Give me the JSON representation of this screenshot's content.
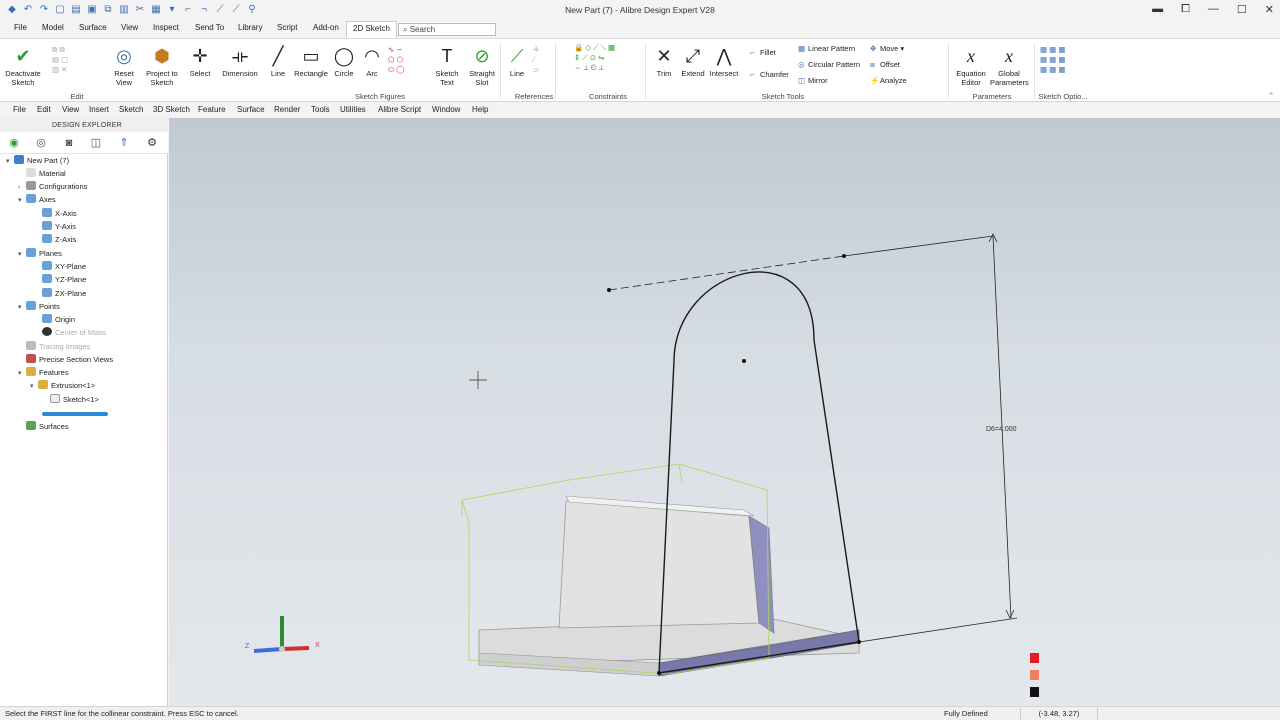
{
  "window": {
    "title": "New Part (7) - Alibre Design Expert V28"
  },
  "ribbon_tabs": [
    "File",
    "Model",
    "Surface",
    "View",
    "Inspect",
    "Send To",
    "Library",
    "Script",
    "Add-on",
    "2D Sketch"
  ],
  "search": {
    "placeholder": "Search"
  },
  "ribbon": {
    "deactivate_sketch": "Deactivate Sketch",
    "reset_view": "Reset View",
    "project_to_sketch": "Project to Sketch",
    "select": "Select",
    "dimension": "Dimension",
    "line": "Line",
    "rectangle": "Rectangle",
    "circle": "Circle",
    "arc": "Arc",
    "sketch_text": "Sketch Text",
    "straight_slot": "Straight Slot",
    "ref_line": "Line",
    "trim": "Trim",
    "extend": "Extend",
    "intersect": "Intersect",
    "fillet": "Fillet",
    "chamfer": "Chamfer",
    "linear_pattern": "Linear Pattern",
    "circular_pattern": "Circular Pattern",
    "mirror": "Mirror",
    "move": "Move",
    "offset": "Offset",
    "analyze": "Analyze",
    "equation_editor": "Equation Editor",
    "global_parameters": "Global Parameters",
    "groups": {
      "edit": "Edit",
      "sketch_figures": "Sketch Figures",
      "references": "References",
      "constraints": "Constraints",
      "sketch_tools": "Sketch Tools",
      "parameters": "Parameters",
      "sketch_options": "Sketch Optio..."
    }
  },
  "menu": [
    "File",
    "Edit",
    "View",
    "Insert",
    "Sketch",
    "3D Sketch",
    "Feature",
    "Surface",
    "Render",
    "Tools",
    "Utilities",
    "Alibre Script",
    "Window",
    "Help"
  ],
  "explorer": {
    "header": "DESIGN EXPLORER",
    "tree": {
      "root": "New Part (7)",
      "material": "Material",
      "configurations": "Configurations",
      "axes": "Axes",
      "x_axis": "X-Axis",
      "y_axis": "Y-Axis",
      "z_axis": "Z-Axis",
      "planes": "Planes",
      "xy_plane": "XY-Plane",
      "yz_plane": "YZ-Plane",
      "zx_plane": "ZX-Plane",
      "points": "Points",
      "origin": "Origin",
      "center_of_mass": "Center of Mass",
      "tracing_images": "Tracing Images",
      "precise_section_views": "Precise Section Views",
      "features": "Features",
      "extrusion": "Extrusion<1>",
      "sketch": "Sketch<1>",
      "surfaces": "Surfaces"
    }
  },
  "viewport": {
    "dimension_label": "D6=4.000",
    "triad": {
      "x": "X",
      "y": "Y",
      "z": "Z"
    },
    "colors": {
      "highlight": "#ff6666",
      "accent": "#e02020"
    }
  },
  "status": {
    "message": "Select the FIRST line for the collinear constraint. Press ESC to cancel.",
    "state": "Fully Defined",
    "coords": "(-3.48, 3.27)"
  }
}
